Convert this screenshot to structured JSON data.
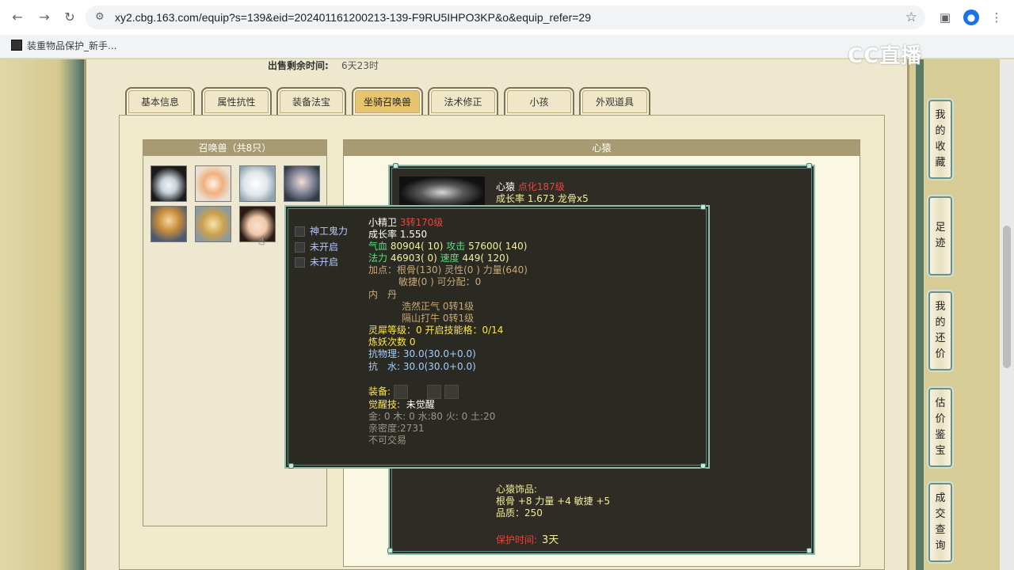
{
  "browser": {
    "url": "xy2.cbg.163.com/equip?s=139&eid=202401161200213-139-F9RU5IHPO3KP&o&equip_refer=29",
    "bookmark": "装重物品保护_新手..."
  },
  "watermark": "CC直播",
  "sale": {
    "label": "出售剩余时间:",
    "value": "6天23时"
  },
  "tabs": [
    {
      "label": "基本信息"
    },
    {
      "label": "属性抗性"
    },
    {
      "label": "装备法宝"
    },
    {
      "label": "坐骑召唤兽"
    },
    {
      "label": "法术修正"
    },
    {
      "label": "小孩"
    },
    {
      "label": "外观道具"
    }
  ],
  "pets_panel": {
    "title": "召唤兽（共8只）"
  },
  "detail_panel": {
    "title": "心猿",
    "mount_name": "心猿",
    "mount_level": "点化187级",
    "mount_growth": "成长率 1.673 龙骨x5",
    "accessory_title": "心猿饰品:",
    "accessory_stats": "根骨 +8 力量 +4 敏捷 +5",
    "accessory_quality": "品质：250",
    "protect_label": "保护时间:",
    "protect_value": "3天"
  },
  "tooltip": {
    "skills": [
      "神工鬼力",
      "未开启",
      "未开启"
    ],
    "name": "小精卫",
    "level": "3转170级",
    "growth": "成长率 1.550",
    "hp_label": "气血",
    "hp": "80904( 10)",
    "atk_label": "攻击",
    "atk": "57600( 140)",
    "mp_label": "法力",
    "mp": "46903( 0)",
    "spd_label": "速度",
    "spd": "449( 120)",
    "points_1": "加点：根骨(130) 灵性(0 ) 力量(640)",
    "points_2": "敏捷(0 ) 可分配：0",
    "neidan_label": "内　丹",
    "neidan_1": "浩然正气 0转1级",
    "neidan_2": "隔山打牛 0转1级",
    "spirit": "灵犀等级：0 开启技能格：0/14",
    "refine": "炼妖次数 0",
    "resist_phys": "抗物理: 30.0(30.0+0.0)",
    "resist_water": "抗　水: 30.0(30.0+0.0)",
    "equip_label": "装备:",
    "awaken_label": "觉醒技:",
    "awaken_value": "未觉醒",
    "elements": "金: 0 木: 0 水:80 火: 0 土:20",
    "intimacy": "亲密度:2731",
    "tradable": "不可交易"
  },
  "side_nav": [
    {
      "label": "我的收藏"
    },
    {
      "label": "足迹"
    },
    {
      "label": "我的还价"
    },
    {
      "label": "估价鉴宝"
    },
    {
      "label": "成交查询"
    }
  ]
}
